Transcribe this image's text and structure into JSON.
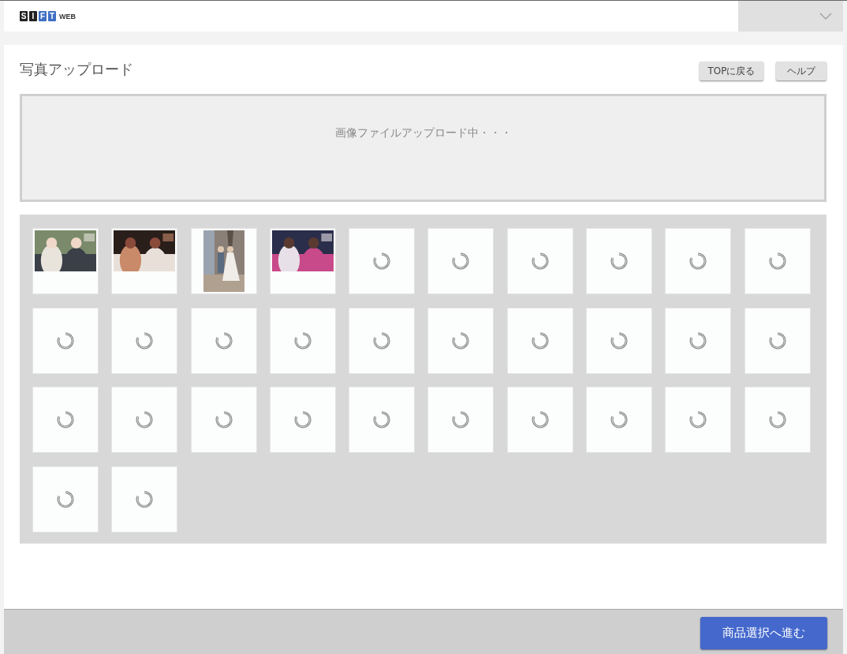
{
  "logo": {
    "letters": [
      {
        "char": "S",
        "color": "#222222"
      },
      {
        "char": "I",
        "color": "#222222"
      },
      {
        "char": "F",
        "color": "#3f6fc4"
      },
      {
        "char": "T",
        "color": "#3f6fc4"
      }
    ],
    "suffix": "WEB"
  },
  "page": {
    "title": "写真アップロード",
    "buttons": [
      "TOPに戻る",
      "ヘルプ"
    ]
  },
  "dropzone": {
    "message": "画像ファイルアップロード中・・・"
  },
  "tiles": [
    {
      "kind": "landscape_photo"
    },
    {
      "kind": "landscape_photo"
    },
    {
      "kind": "portrait_photo"
    },
    {
      "kind": "landscape_photo"
    },
    {
      "kind": "loading"
    },
    {
      "kind": "loading"
    },
    {
      "kind": "loading"
    },
    {
      "kind": "loading"
    },
    {
      "kind": "loading"
    },
    {
      "kind": "loading"
    },
    {
      "kind": "loading"
    },
    {
      "kind": "loading"
    },
    {
      "kind": "loading"
    },
    {
      "kind": "loading"
    },
    {
      "kind": "loading"
    },
    {
      "kind": "loading"
    },
    {
      "kind": "loading"
    },
    {
      "kind": "loading"
    },
    {
      "kind": "loading"
    },
    {
      "kind": "loading"
    },
    {
      "kind": "loading"
    },
    {
      "kind": "loading"
    },
    {
      "kind": "loading"
    },
    {
      "kind": "loading"
    },
    {
      "kind": "loading"
    },
    {
      "kind": "loading"
    },
    {
      "kind": "loading"
    },
    {
      "kind": "loading"
    },
    {
      "kind": "loading"
    },
    {
      "kind": "loading"
    },
    {
      "kind": "loading"
    },
    {
      "kind": "loading"
    }
  ],
  "footer": {
    "next_button": "商品選択へ進む"
  }
}
